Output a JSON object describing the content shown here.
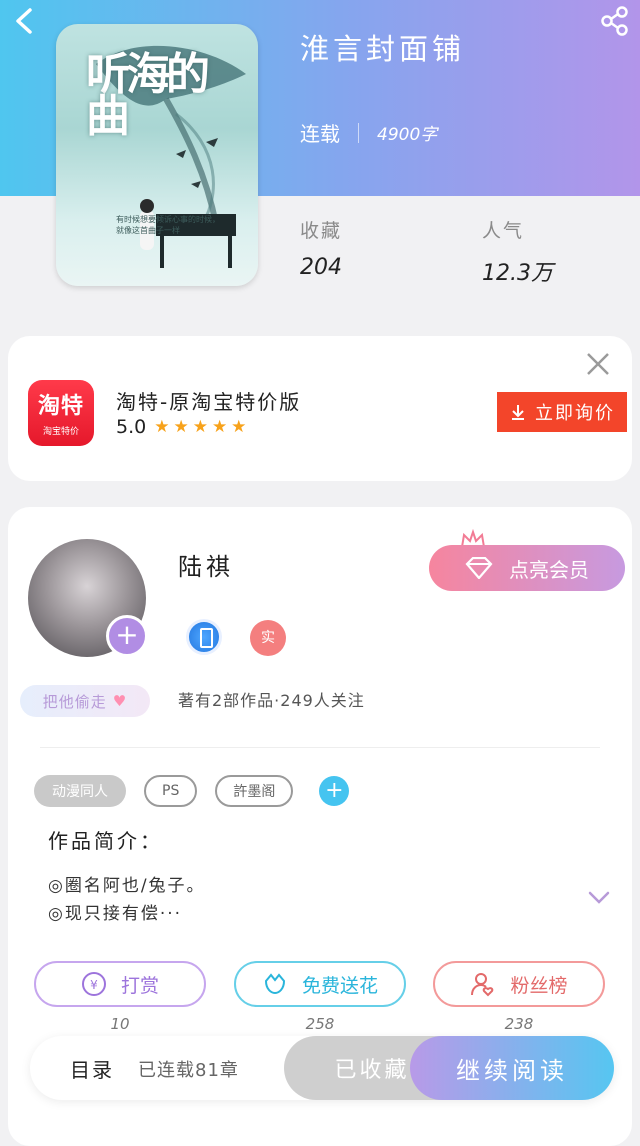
{
  "header": {
    "book_title": "淮言封面铺",
    "status": "连载",
    "word_count": "4900字",
    "stats": [
      {
        "label": "收藏",
        "value": "204"
      },
      {
        "label": "人气",
        "value": "12.3万"
      }
    ],
    "cover": {
      "title": "听海的曲",
      "subtitle": "有时候想要倾诉心事的时候，就像这首曲子一样"
    }
  },
  "ad": {
    "logo_text": "淘特",
    "logo_sub": "淘宝特价",
    "name": "淘特-原淘宝特价版",
    "rating": "5.0",
    "stars": "★★★★★",
    "cta": "立即询价"
  },
  "author": {
    "name": "陆祺",
    "badge_b": "实",
    "steal_label": "把他偷走",
    "follow_text": "著有2部作品·249人关注",
    "vip_label": "点亮会员"
  },
  "tags": [
    "动漫同人",
    "PS",
    "許墨阁"
  ],
  "intro": {
    "title": "作品简介：",
    "lines": [
      "◎圈名阿也/兔子。",
      "◎现只接有偿···"
    ]
  },
  "actions": [
    {
      "label": "打赏",
      "count": "10"
    },
    {
      "label": "免费送花",
      "count": "258"
    },
    {
      "label": "粉丝榜",
      "count": "238"
    }
  ],
  "bottom": {
    "toc": "目录",
    "progress": "已连载81章",
    "collected": "已收藏",
    "continue": "继续阅读"
  },
  "colors": {
    "header_start": "#4fc6ef",
    "header_end": "#b295ea",
    "ad_cta": "#f3452a"
  }
}
